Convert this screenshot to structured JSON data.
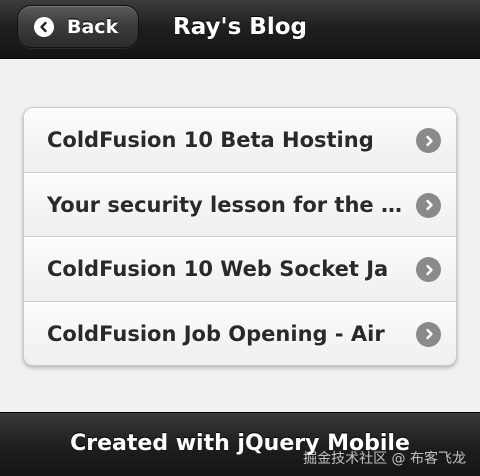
{
  "header": {
    "back_label": "Back",
    "title": "Ray's Blog"
  },
  "list": {
    "items": [
      {
        "label": "ColdFusion 10 Beta Hosting"
      },
      {
        "label": "Your security lesson for the day"
      },
      {
        "label": "ColdFusion 10 Web Socket Ja"
      },
      {
        "label": "ColdFusion Job Opening - Air"
      }
    ]
  },
  "footer": {
    "text": "Created with jQuery Mobile"
  },
  "watermark": {
    "text": "掘金技术社区 @ 布客飞龙"
  },
  "icons": {
    "back": "arrow-left-icon",
    "item": "chevron-right-icon"
  },
  "colors": {
    "bar": "#1e1e1e",
    "page": "#f1f1f1",
    "item_text": "#2a2a2a",
    "chevron": "#8a8a8a"
  }
}
